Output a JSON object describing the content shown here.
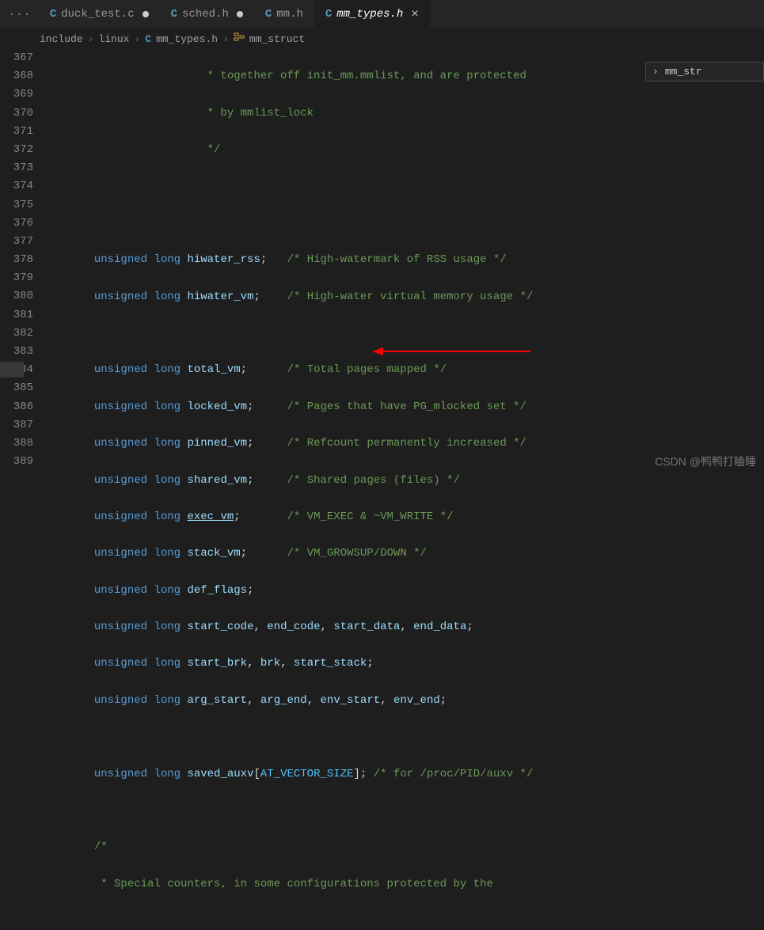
{
  "tabs": {
    "dots": "···",
    "items": [
      {
        "icon": "C",
        "name": "duck_test.c",
        "modified": true,
        "active": false
      },
      {
        "icon": "C",
        "name": "sched.h",
        "modified": true,
        "active": false
      },
      {
        "icon": "C",
        "name": "mm.h",
        "modified": false,
        "active": false
      },
      {
        "icon": "C",
        "name": "mm_types.h",
        "modified": false,
        "active": true
      }
    ]
  },
  "breadcrumb": {
    "seg1": "include",
    "seg2": "linux",
    "file_icon": "C",
    "file": "mm_types.h",
    "struct": "mm_struct"
  },
  "outline": {
    "label": "mm_str"
  },
  "watermark": "CSDN @鸭鸭打瞌睡",
  "gutter": [
    "367",
    "368",
    "369",
    "370",
    "371",
    "372",
    "373",
    "374",
    "375",
    "376",
    "377",
    "378",
    "379",
    "380",
    "381",
    "382",
    "383",
    "384",
    "385",
    "386",
    "387",
    "388",
    "389",
    ""
  ],
  "code": {
    "c367a": "                        * together off init_mm.mmlist, and are protected",
    "c368a": "                        * by mmlist_lock",
    "c369a": "                        */",
    "c372_kw1": "unsigned",
    "c372_kw2": "long",
    "c372_id": "hiwater_rss",
    "c372_cm": "/* High-watermark of RSS usage */",
    "c373_kw1": "unsigned",
    "c373_kw2": "long",
    "c373_id": "hiwater_vm",
    "c373_cm": "/* High-water virtual memory usage */",
    "c375_kw1": "unsigned",
    "c375_kw2": "long",
    "c375_id": "total_vm",
    "c375_cm": "/* Total pages mapped */",
    "c376_kw1": "unsigned",
    "c376_kw2": "long",
    "c376_id": "locked_vm",
    "c376_cm": "/* Pages that have PG_mlocked set */",
    "c377_kw1": "unsigned",
    "c377_kw2": "long",
    "c377_id": "pinned_vm",
    "c377_cm": "/* Refcount permanently increased */",
    "c378_kw1": "unsigned",
    "c378_kw2": "long",
    "c378_id": "shared_vm",
    "c378_cm": "/* Shared pages (files) */",
    "c379_kw1": "unsigned",
    "c379_kw2": "long",
    "c379_id": "exec_vm",
    "c379_cm": "/* VM_EXEC & ~VM_WRITE */",
    "c380_kw1": "unsigned",
    "c380_kw2": "long",
    "c380_id": "stack_vm",
    "c380_cm": "/* VM_GROWSUP/DOWN */",
    "c381_kw1": "unsigned",
    "c381_kw2": "long",
    "c381_id": "def_flags",
    "c382_kw1": "unsigned",
    "c382_kw2": "long",
    "c382_id1": "start_code",
    "c382_id2": "end_code",
    "c382_id3": "start_data",
    "c382_id4": "end_data",
    "c383_kw1": "unsigned",
    "c383_kw2": "long",
    "c383_id1": "start_brk",
    "c383_id2": "brk",
    "c383_id3": "start_stack",
    "c384_kw1": "unsigned",
    "c384_kw2": "long",
    "c384_id1": "arg_start",
    "c384_id2": "arg_end",
    "c384_id3": "env_start",
    "c384_id4": "env_end",
    "c386_kw1": "unsigned",
    "c386_kw2": "long",
    "c386_id": "saved_auxv",
    "c386_mc": "AT_VECTOR_SIZE",
    "c386_cm": "/* for /proc/PID/auxv */",
    "c388a": "/*",
    "c389a": " * Special counters, in some configurations protected by the"
  }
}
